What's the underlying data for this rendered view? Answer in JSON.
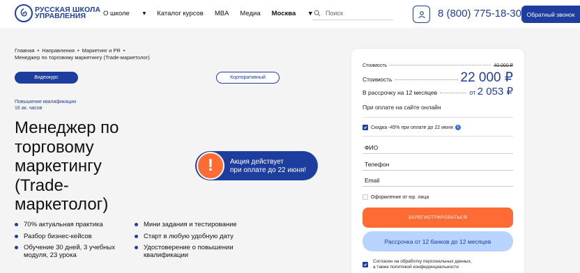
{
  "header": {
    "logo_line1": "РУССКАЯ ШКОЛА",
    "logo_line2": "УПРАВЛЕНИЯ",
    "nav": {
      "about": "О школе",
      "catalog": "Каталог курсов",
      "mba": "MBA",
      "media": "Медиа",
      "city": "Москва"
    },
    "search_placeholder": "Поиск",
    "phone": "8 (800) 775-18-30",
    "callback": "Обратный звонок"
  },
  "breadcrumbs": {
    "home": "Главная",
    "directions": "Направления",
    "marketing": "Маркетинг и PR",
    "current": "Менеджер по торговому маркетингу (Trade-маркетолог)"
  },
  "format": {
    "video": "Видеокурс",
    "corporate": "Корпоративный"
  },
  "course": {
    "qualification": "Повышение квалификации",
    "hours": "16 ак. часов",
    "title": "Менеджер по торговому маркетингу (Trade-маркетолог)"
  },
  "promo": {
    "icon": "!",
    "line1": "Акция действует",
    "line2": "при оплате до 22 июня!"
  },
  "features": {
    "f1": "70% актуальная практика",
    "f2": "Мини задания и тестирование",
    "f3": "Разбор бизнес-кейсов",
    "f4": "Старт в любую удобную дату",
    "f5a": "Обучение 30 дней, 3 учебных",
    "f5b": "модуля, 23 урока",
    "f6a": "Удостоверение о повышении",
    "f6b": "квалификации"
  },
  "pricing": {
    "cost_small_label": "Стоимость",
    "old_price": "40 000 ₽",
    "cost_label": "Стоимость",
    "price": "22 000 ₽",
    "installment_label": "В рассрочку на 12 месяцев",
    "installment_from": "от",
    "installment_price": "2 053 ₽",
    "online_label": "При оплате на сайте онлайн",
    "discount_label": "Скидка -45% при оплате до 22 июня",
    "discount_checked": true
  },
  "form": {
    "name": "ФИО",
    "phone": "Телефон",
    "email": "Email",
    "legal_label": "Оформление от юр. лица",
    "register": "ЗАРЕГИСТРИРОВАТЬСЯ",
    "installment_btn": "Рассрочка от 12 банков до 12 месяцев",
    "consent_line1": "Согласен на обработку персональных данных,",
    "consent_line2": "а также политикой конфиденциальности"
  },
  "colors": {
    "brand": "#1d3e9e",
    "accent": "#ff6b35",
    "light_blue": "#b9d3ff"
  }
}
